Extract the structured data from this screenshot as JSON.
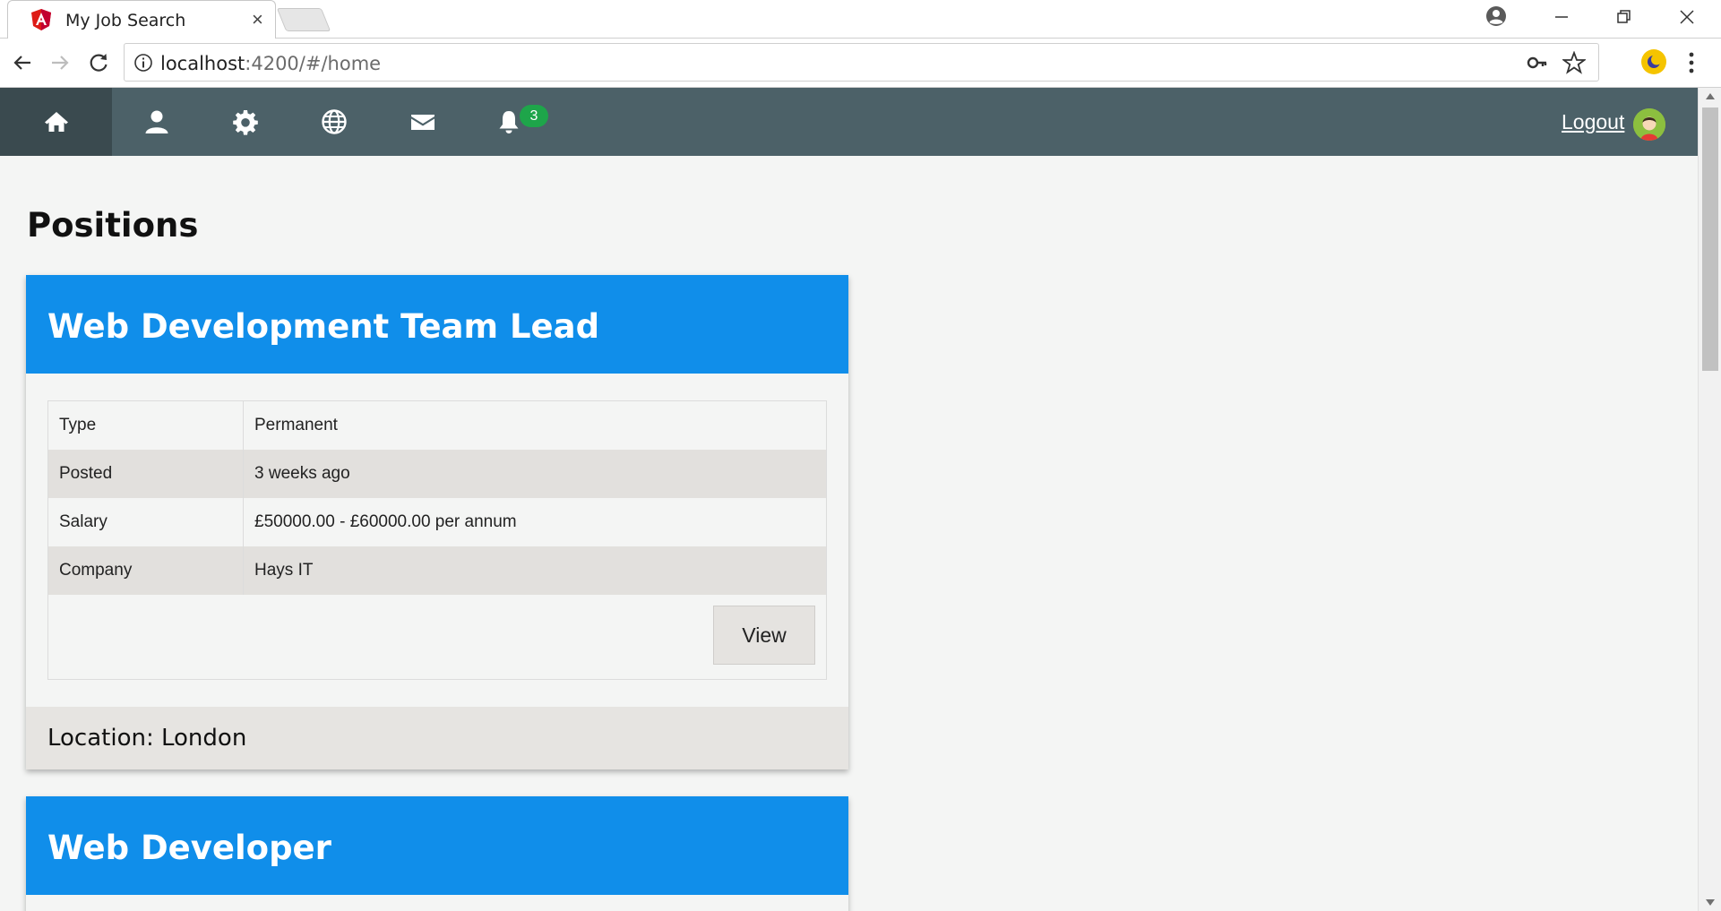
{
  "browser": {
    "tab_title": "My Job Search",
    "tab_close": "×",
    "url_host": "localhost",
    "url_rest": ":4200/#/home",
    "window_controls": [
      "minimize-icon",
      "restore-icon",
      "close-icon"
    ]
  },
  "navbar": {
    "items": [
      {
        "name": "home",
        "icon": "home-icon",
        "active": true
      },
      {
        "name": "profile",
        "icon": "user-icon"
      },
      {
        "name": "settings",
        "icon": "gear-icon"
      },
      {
        "name": "web",
        "icon": "globe-icon"
      },
      {
        "name": "messages",
        "icon": "envelope-icon"
      },
      {
        "name": "notifications",
        "icon": "bell-icon"
      }
    ],
    "notification_count": "3",
    "logout_label": "Logout"
  },
  "page": {
    "title": "Positions"
  },
  "positions": [
    {
      "title": "Web Development Team Lead",
      "details": [
        {
          "label": "Type",
          "value": "Permanent"
        },
        {
          "label": "Posted",
          "value": "3 weeks ago"
        },
        {
          "label": "Salary",
          "value": "£50000.00 - £60000.00 per annum"
        },
        {
          "label": "Company",
          "value": "Hays IT"
        }
      ],
      "view_label": "View",
      "location": "Location: London"
    },
    {
      "title": "Web Developer"
    }
  ],
  "colors": {
    "navbar": "#4c6168",
    "card_header": "#108eea",
    "badge": "#1ea54a"
  }
}
